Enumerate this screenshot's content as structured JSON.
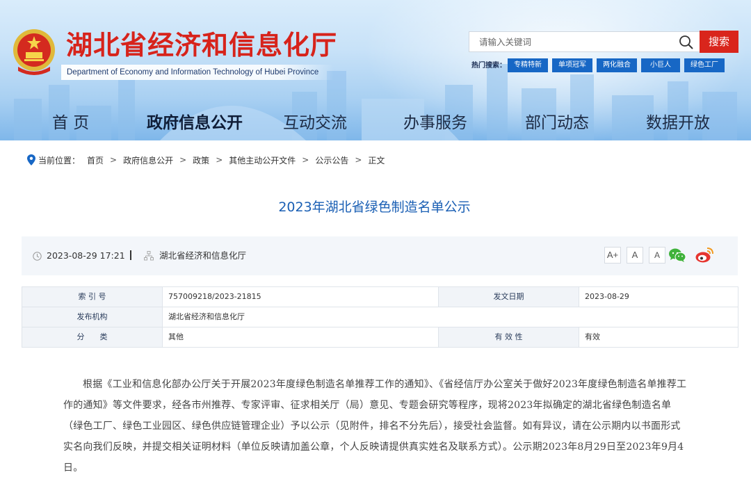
{
  "header": {
    "title": "湖北省经济和信息化厅",
    "subtitle": "Department of Economy and Information Technology of Hubei Province",
    "search": {
      "placeholder": "请输入关键词",
      "button_label": "搜索"
    },
    "hot_search": {
      "label": "热门搜索：",
      "tags": [
        "专精特新",
        "单项冠军",
        "两化融合",
        "小巨人",
        "绿色工厂"
      ]
    },
    "colors": {
      "title_red": "#d7231b",
      "tag_blue": "#1767c5",
      "search_red": "#d9251c"
    }
  },
  "nav": {
    "items": [
      "首 页",
      "政府信息公开",
      "互动交流",
      "办事服务",
      "部门动态",
      "数据开放"
    ],
    "active": "政府信息公开"
  },
  "breadcrumb": {
    "label": "当前位置：",
    "items": [
      "首页",
      "政府信息公开",
      "政策",
      "其他主动公开文件",
      "公示公告",
      "正文"
    ],
    "separator": ">"
  },
  "article": {
    "title": "2023年湖北省绿色制造名单公示",
    "date": "2023-08-29 17:21",
    "source": "湖北省经济和信息化厅",
    "font_sizes": [
      "A+",
      "A",
      "A"
    ],
    "share": [
      "wechat-icon",
      "weibo-icon"
    ],
    "info": {
      "index_label": "索 引 号",
      "index_value": "757009218/2023-21815",
      "date_label": "发文日期",
      "date_value": "2023-08-29",
      "publisher_label": "发布机构",
      "publisher_value": "湖北省经济和信息化厅",
      "category_label": "分　　类",
      "category_value": "其他",
      "validity_label": "有 效 性",
      "validity_value": "有效"
    },
    "body": "根据《工业和信息化部办公厅关于开展2023年度绿色制造名单推荐工作的通知》、《省经信厅办公室关于做好2023年度绿色制造名单推荐工作的通知》等文件要求，经各市州推荐、专家评审、征求相关厅（局）意见、专题会研究等程序，现将2023年拟确定的湖北省绿色制造名单（绿色工厂、绿色工业园区、绿色供应链管理企业）予以公示（见附件，排名不分先后），接受社会监督。如有异议，请在公示期内以书面形式实名向我们反映，并提交相关证明材料（单位反映请加盖公章，个人反映请提供真实姓名及联系方式）。公示期2023年8月29日至2023年9月4日。"
  }
}
